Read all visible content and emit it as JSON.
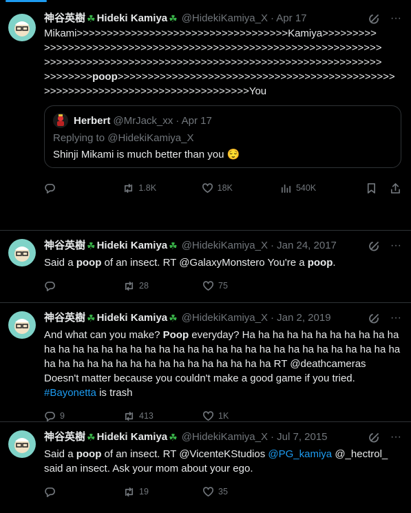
{
  "tweets": [
    {
      "display_name": "神谷英樹",
      "name": "Hideki Kamiya",
      "handle": "@HidekiKamiya_X",
      "date": "· Apr 17",
      "text_lines": [
        "Mikami>>>>>>>>>>>>>>>>>>>>>>>>>>>>>>>>>>>Kamiya>>>>>>>>>",
        ">>>>>>>>>>>>>>>>>>>>>>>>>>>>>>>>>>>>>>>>>>>>>>>>>>>>>>>>",
        ">>>>>>>>>>>>>>>>>>>>>>>>>>>>>>>>>>>>>>>>>>>>>>>>>>>>>>>>",
        ">>>>>>>>"
      ],
      "poop_word": "poop",
      "after_poop": ">>>>>>>>>>>>>>>>>>>>>>>>>>>>>>>>>>>>>>>>>>>>>>",
      "last_line": ">>>>>>>>>>>>>>>>>>>>>>>>>>>>>>>>>>You",
      "quote": {
        "name": "Herbert",
        "handle": "@MrJack_xx",
        "date": "· Apr 17",
        "replying": "Replying to @HidekiKamiya_X",
        "text": "Shinji Mikami is much better than you 😌"
      },
      "replies": "",
      "retweets": "1.8K",
      "likes": "18K",
      "views": "540K"
    },
    {
      "display_name": "神谷英樹",
      "name": "Hideki Kamiya",
      "handle": "@HidekiKamiya_X",
      "date": "· Jan 24, 2017",
      "text_a": "Said a ",
      "text_bold_a": "poop",
      "text_b": " of an insect. RT @GalaxyMonstero You're a ",
      "text_bold_b": "poop",
      "text_c": ".",
      "replies": "",
      "retweets": "28",
      "likes": "75",
      "views": ""
    },
    {
      "display_name": "神谷英樹",
      "name": "Hideki Kamiya",
      "handle": "@HidekiKamiya_X",
      "date": "· Jan 2, 2019",
      "text_a": "And what can you make? ",
      "text_bold_a": "Poop",
      "text_b": " everyday? Ha ha ha ha ha ha ha ha ha ha ha ha ha ha ha ha ha ha ha ha ha ha ha ha ha ha ha ha ha ha ha ha ha ha ha ha ha ha ha ha ha ha ha ha ha ha ha ha ha ha ha ha RT @deathcameras Doesn't matter because you couldn't make a good game if you tried. ",
      "hashtag": "#Bayonetta",
      "text_c": " is trash",
      "replies": "9",
      "retweets": "413",
      "likes": "1K",
      "views": ""
    },
    {
      "display_name": "神谷英樹",
      "name": "Hideki Kamiya",
      "handle": "@HidekiKamiya_X",
      "date": "· Jul 7, 2015",
      "text_a": "Said a ",
      "text_bold_a": "poop",
      "text_b": " of an insect. RT @VicenteKStudios ",
      "mention": "@PG_kamiya",
      "text_c": " @_hectrol_ said an insect. Ask your mom about your ego.",
      "replies": "",
      "retweets": "19",
      "likes": "35",
      "views": ""
    }
  ],
  "icons": [
    "grok-icon",
    "more-icon",
    "reply-icon",
    "retweet-icon",
    "like-icon",
    "views-icon",
    "bookmark-icon",
    "share-icon"
  ],
  "colors": {
    "accent": "#1d9bf0",
    "muted": "#71767b",
    "divider": "#2f3336",
    "clover": "#3ab54a"
  }
}
